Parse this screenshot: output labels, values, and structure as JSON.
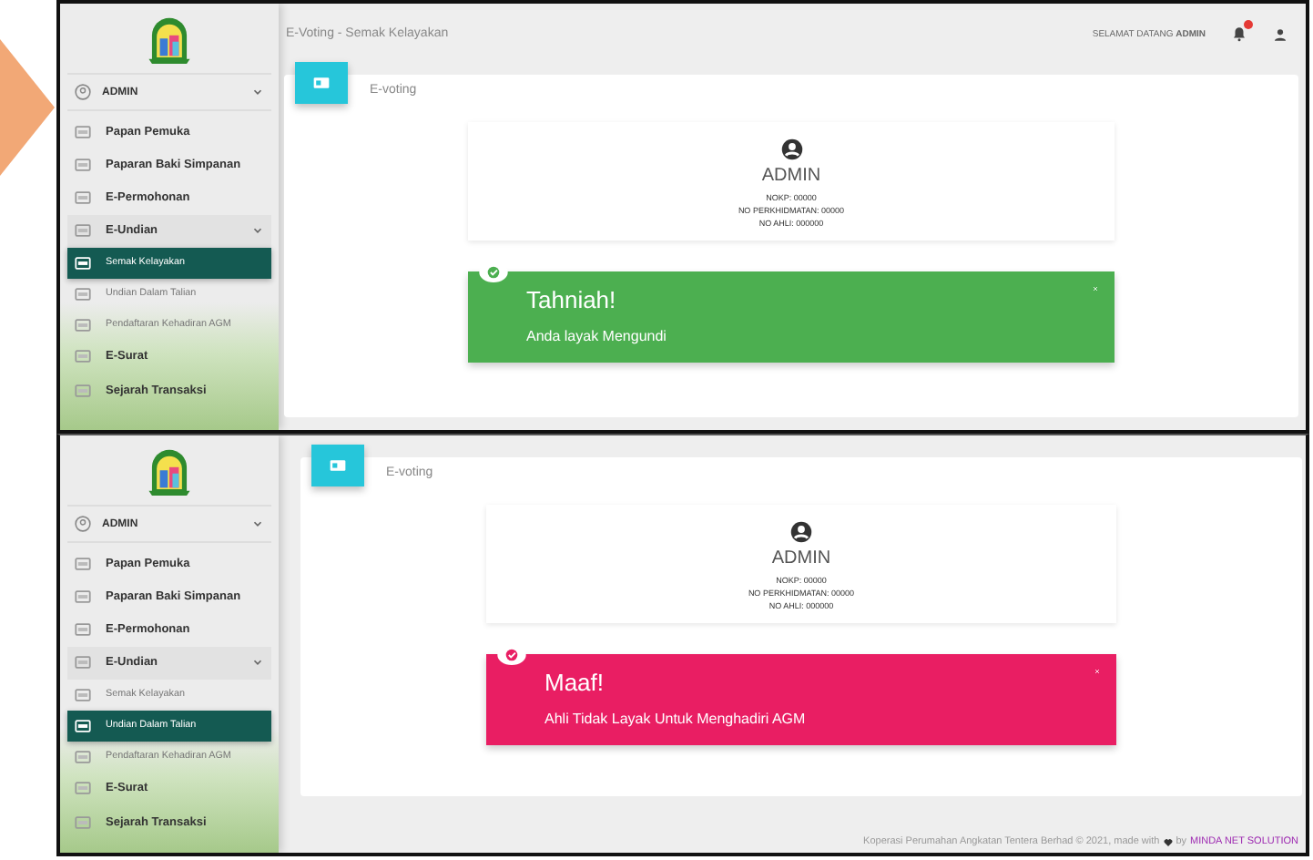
{
  "panels": [
    {
      "topbar": {
        "title": "E-Voting - Semak Kelayakan",
        "greeting": "SELAMAT DATANG **ADMIN**"
      },
      "sidebar": {
        "user": "ADMIN",
        "items": [
          {
            "label": "Papan Pemuka",
            "selected": false
          },
          {
            "label": "Paparan Baki Simpanan",
            "selected": false
          },
          {
            "label": "E-Permohonan",
            "selected": false
          },
          {
            "label": "E-Undian",
            "selected": false,
            "expanded": true,
            "children": [
              {
                "label": "Semak Kelayakan",
                "selected": true
              },
              {
                "label": "Undian Dalam Talian",
                "selected": false
              },
              {
                "label": "Pendaftaran Kehadiran AGM",
                "selected": false
              }
            ]
          },
          {
            "label": "E-Surat",
            "selected": false
          },
          {
            "label": "Sejarah Transaksi",
            "selected": false
          }
        ]
      },
      "card": {
        "tab_label": "E-voting",
        "profile": {
          "name": "ADMIN",
          "lines": [
            "NOKP: 00000",
            "NO PERKHIDMATAN: 00000",
            "NO AHLI: 000000"
          ]
        },
        "alert": {
          "kind": "success",
          "title": "Tahniah!",
          "message": "Anda layak Mengundi"
        }
      }
    },
    {
      "sidebar": {
        "user": "ADMIN",
        "items": [
          {
            "label": "Papan Pemuka",
            "selected": false
          },
          {
            "label": "Paparan Baki Simpanan",
            "selected": false
          },
          {
            "label": "E-Permohonan",
            "selected": false
          },
          {
            "label": "E-Undian",
            "selected": false,
            "expanded": true,
            "children": [
              {
                "label": "Semak Kelayakan",
                "selected": false
              },
              {
                "label": "Undian Dalam Talian",
                "selected": true
              },
              {
                "label": "Pendaftaran Kehadiran AGM",
                "selected": false
              }
            ]
          },
          {
            "label": "E-Surat",
            "selected": false
          },
          {
            "label": "Sejarah Transaksi",
            "selected": false
          }
        ]
      },
      "card": {
        "tab_label": "E-voting",
        "profile": {
          "name": "ADMIN",
          "lines": [
            "NOKP: 00000",
            "NO PERKHIDMATAN: 00000",
            "NO AHLI: 000000"
          ]
        },
        "alert": {
          "kind": "danger",
          "title": "Maaf!",
          "message": "Ahli Tidak Layak Untuk Menghadiri AGM"
        }
      },
      "footer": {
        "text": "Koperasi Perumahan Angkatan Tentera Berhad © 2021, made with",
        "by": "by",
        "link": "MINDA NET SOLUTION"
      }
    }
  ]
}
